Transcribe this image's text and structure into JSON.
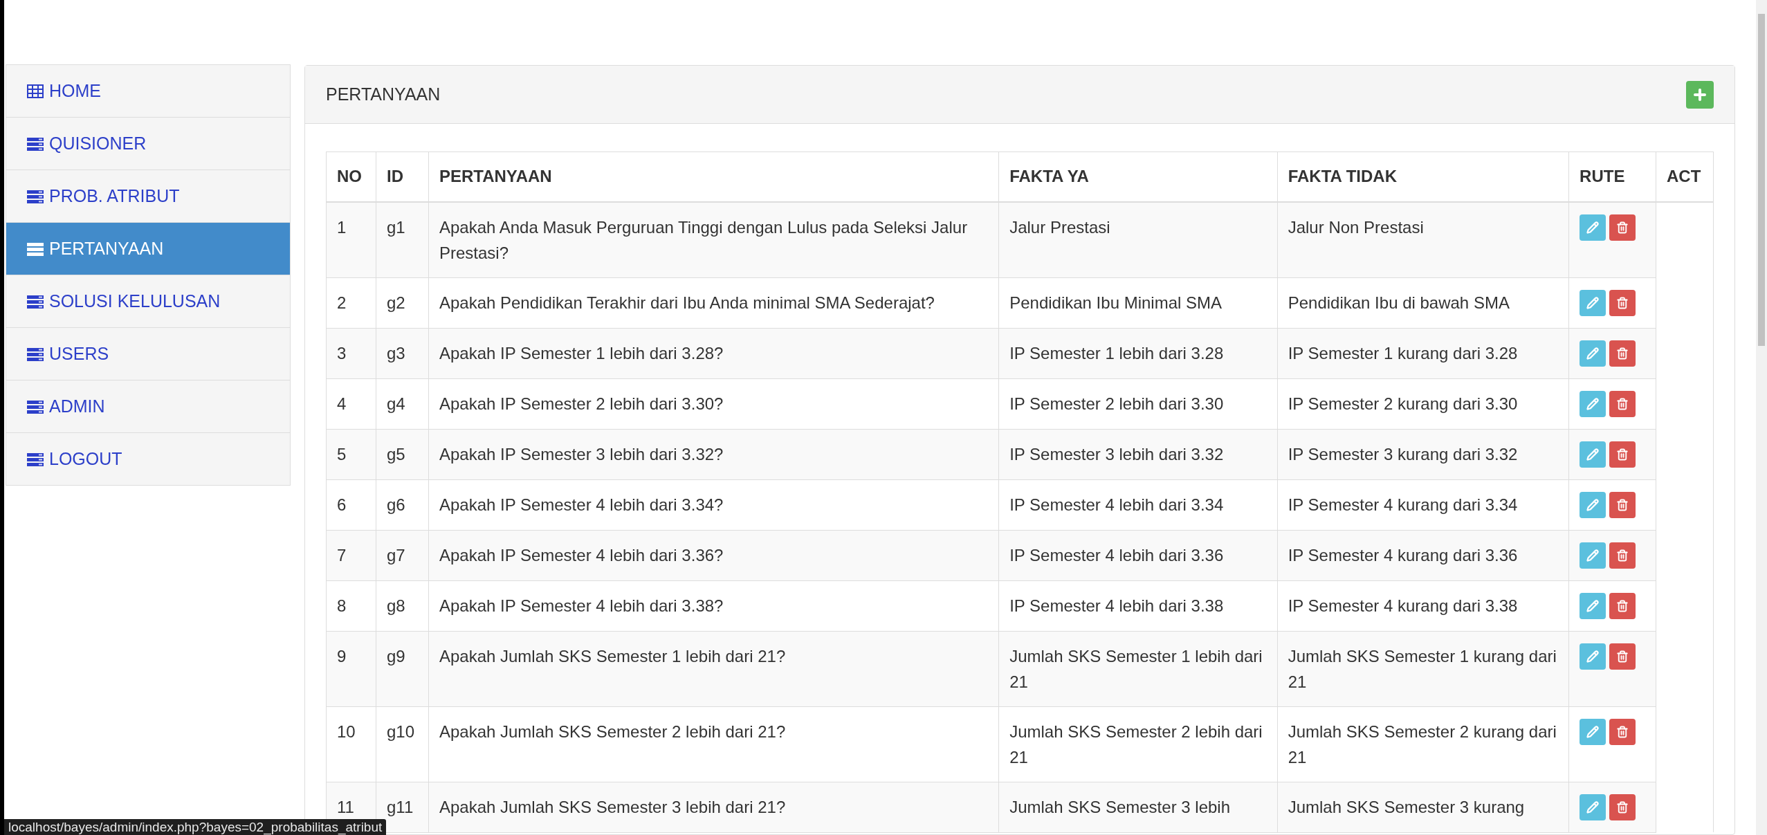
{
  "sidebar": {
    "items": [
      {
        "label": "HOME",
        "kind": "table",
        "selected": false
      },
      {
        "label": "QUISIONER",
        "kind": "list",
        "selected": false
      },
      {
        "label": "PROB. ATRIBUT",
        "kind": "list",
        "selected": false
      },
      {
        "label": "PERTANYAAN",
        "kind": "list",
        "selected": true
      },
      {
        "label": "SOLUSI KELULUSAN",
        "kind": "list",
        "selected": false
      },
      {
        "label": "USERS",
        "kind": "list",
        "selected": false
      },
      {
        "label": "ADMIN",
        "kind": "list",
        "selected": false
      },
      {
        "label": "LOGOUT",
        "kind": "list",
        "selected": false
      }
    ]
  },
  "panel": {
    "title": "PERTANYAAN"
  },
  "table": {
    "columns": [
      "NO",
      "ID",
      "PERTANYAAN",
      "FAKTA YA",
      "FAKTA TIDAK",
      "RUTE",
      "ACT"
    ],
    "rows": [
      {
        "no": "1",
        "id": "g1",
        "question": "Apakah Anda Masuk Perguruan Tinggi dengan Lulus pada Seleksi Jalur Prestasi?",
        "yes": "Jalur Prestasi",
        "no_fact": "Jalur Non Prestasi"
      },
      {
        "no": "2",
        "id": "g2",
        "question": "Apakah Pendidikan Terakhir dari Ibu Anda minimal SMA Sederajat?",
        "yes": "Pendidikan Ibu Minimal SMA",
        "no_fact": "Pendidikan Ibu di bawah SMA"
      },
      {
        "no": "3",
        "id": "g3",
        "question": "Apakah IP Semester 1 lebih dari 3.28?",
        "yes": "IP Semester 1 lebih dari 3.28",
        "no_fact": "IP Semester 1 kurang dari 3.28"
      },
      {
        "no": "4",
        "id": "g4",
        "question": "Apakah IP Semester 2 lebih dari 3.30?",
        "yes": "IP Semester 2 lebih dari 3.30",
        "no_fact": "IP Semester 2 kurang dari 3.30"
      },
      {
        "no": "5",
        "id": "g5",
        "question": "Apakah IP Semester 3 lebih dari 3.32?",
        "yes": "IP Semester 3 lebih dari 3.32",
        "no_fact": "IP Semester 3 kurang dari 3.32"
      },
      {
        "no": "6",
        "id": "g6",
        "question": "Apakah IP Semester 4 lebih dari 3.34?",
        "yes": "IP Semester 4 lebih dari 3.34",
        "no_fact": "IP Semester 4 kurang dari 3.34"
      },
      {
        "no": "7",
        "id": "g7",
        "question": "Apakah IP Semester 4 lebih dari 3.36?",
        "yes": "IP Semester 4 lebih dari 3.36",
        "no_fact": "IP Semester 4 kurang dari 3.36"
      },
      {
        "no": "8",
        "id": "g8",
        "question": "Apakah IP Semester 4 lebih dari 3.38?",
        "yes": "IP Semester 4 lebih dari 3.38",
        "no_fact": "IP Semester 4 kurang dari 3.38"
      },
      {
        "no": "9",
        "id": "g9",
        "question": "Apakah Jumlah SKS Semester 1 lebih dari 21?",
        "yes": "Jumlah SKS Semester 1 lebih dari 21",
        "no_fact": "Jumlah SKS Semester 1 kurang dari 21"
      },
      {
        "no": "10",
        "id": "g10",
        "question": "Apakah Jumlah SKS Semester 2 lebih dari 21?",
        "yes": "Jumlah SKS Semester 2 lebih dari 21",
        "no_fact": "Jumlah SKS Semester 2 kurang dari 21"
      },
      {
        "no": "11",
        "id": "g11",
        "question": "Apakah Jumlah SKS Semester 3 lebih dari 21?",
        "yes": "Jumlah SKS Semester 3 lebih",
        "no_fact": "Jumlah SKS Semester 3 kurang"
      }
    ]
  },
  "status_bar": {
    "url": "localhost/bayes/admin/index.php?bayes=02_probabilitas_atribut"
  }
}
